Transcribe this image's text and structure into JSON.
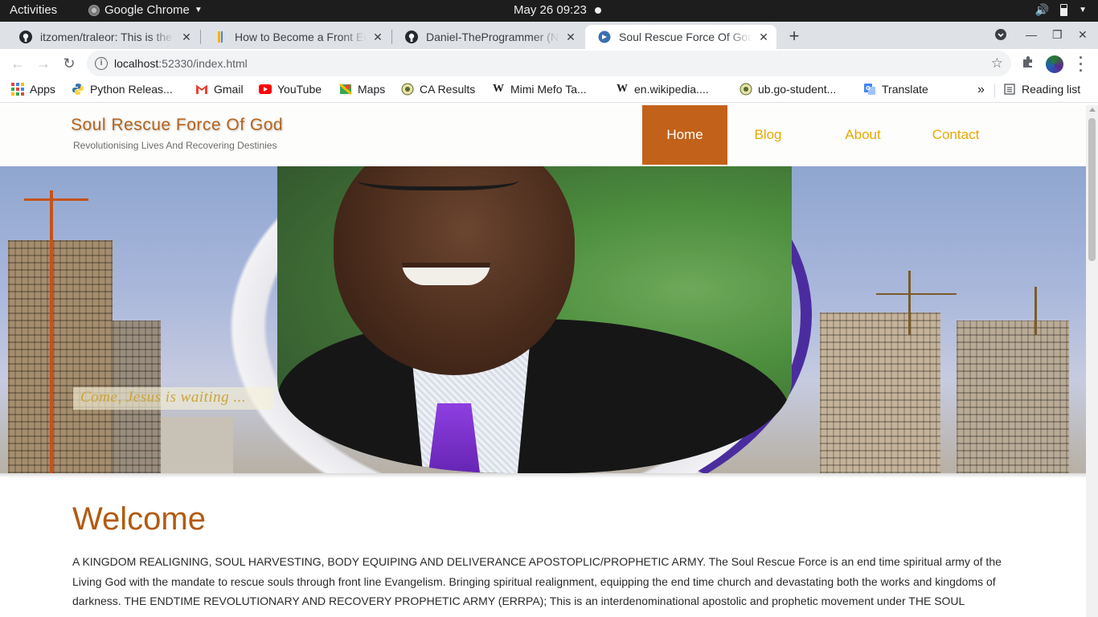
{
  "system": {
    "activities": "Activities",
    "app_name": "Google Chrome",
    "clock": "May 26  09:23"
  },
  "tabs": [
    {
      "title": "itzomen/traleor: This is the",
      "icon": "github-icon"
    },
    {
      "title": "How to Become a Front End",
      "icon": "bookmark-favicon"
    },
    {
      "title": "Daniel-TheProgrammer (N",
      "icon": "github-icon"
    },
    {
      "title": "Soul Rescue Force Of God",
      "icon": "site-favicon",
      "active": true
    }
  ],
  "omnibox": {
    "host": "localhost",
    "path": ":52330/index.html"
  },
  "bookmarks": [
    {
      "label": "Apps",
      "icon": "apps-grid-icon"
    },
    {
      "label": "Python Releas...",
      "icon": "python-icon"
    },
    {
      "label": "Gmail",
      "icon": "gmail-icon"
    },
    {
      "label": "YouTube",
      "icon": "youtube-icon"
    },
    {
      "label": "Maps",
      "icon": "maps-icon"
    },
    {
      "label": "CA Results",
      "icon": "ca-icon"
    },
    {
      "label": "Mimi Mefo Ta...",
      "icon": "wikipedia-icon"
    },
    {
      "label": "en.wikipedia....",
      "icon": "wikipedia-icon"
    },
    {
      "label": "ub.go-student...",
      "icon": "ub-icon"
    },
    {
      "label": "Translate",
      "icon": "translate-icon"
    }
  ],
  "reading_list": "Reading list",
  "site": {
    "brand": "Soul Rescue Force Of God",
    "tagline": "Revolutionising Lives And Recovering Destinies",
    "nav": [
      "Home",
      "Blog",
      "About",
      "Contact"
    ],
    "active_nav": "Home",
    "hero_caption": "Come, Jesus is waiting ...",
    "welcome_heading": "Welcome",
    "intro_text": "A KINGDOM REALIGNING, SOUL HARVESTING, BODY EQUIPING AND DELIVERANCE APOSTOPLIC/PROPHETIC ARMY. The Soul Rescue Force is an end time spiritual army of the Living God with the mandate to rescue souls through front line Evangelism. Bringing spiritual realignment, equipping the end time church and devastating both the works and kingdoms of darkness. THE ENDTIME REVOLUTIONARY AND RECOVERY PROPHETIC ARMY (ERRPA); This is an interdenominational apostolic and prophetic movement under THE SOUL"
  },
  "colors": {
    "brand": "#b5651d",
    "nav_link": "#e8a800",
    "nav_active_bg": "#c2611a",
    "heading": "#b35a10"
  }
}
